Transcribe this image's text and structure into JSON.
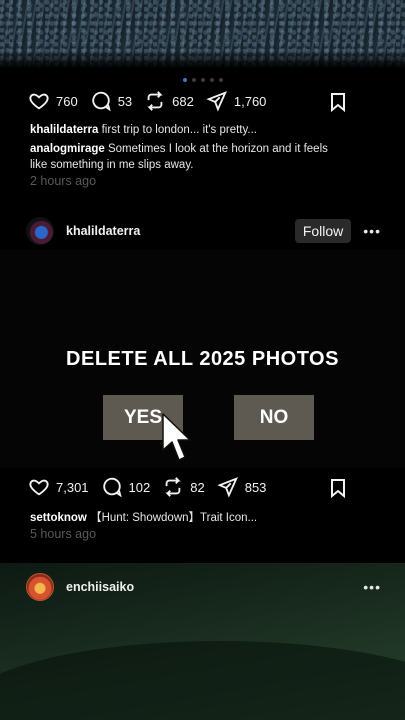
{
  "post1": {
    "likes": "760",
    "comments": "53",
    "reposts": "682",
    "shares": "1,760",
    "caption_user": "khalildaterra",
    "caption_text": "first trip to london... it's pretty...",
    "comment_user": "analogmirage",
    "comment_text": "Sometimes I look at the horizon and it feels like something in me slips away.",
    "timestamp": "2 hours ago"
  },
  "profile1": {
    "username": "khalildaterra",
    "follow_label": "Follow",
    "more_label": "•••"
  },
  "dialog": {
    "title": "DELETE ALL 2025 PHOTOS",
    "yes_label": "YES",
    "no_label": "NO"
  },
  "post2": {
    "likes": "7,301",
    "comments": "102",
    "reposts": "82",
    "shares": "853",
    "caption_user": "settoknow",
    "caption_text": "【Hunt: Showdown】Trait Icon...",
    "timestamp": "5 hours ago"
  },
  "profile2": {
    "username": "enchiisaiko",
    "more_label": "•••"
  },
  "carousel": {
    "count": 5,
    "active_index": 0
  },
  "icons": [
    "heart-icon",
    "comment-icon",
    "repost-icon",
    "share-icon",
    "bookmark-icon",
    "cursor-icon"
  ],
  "colors": {
    "dialog_button": "#5f5a51",
    "carousel_active": "#4a72c9"
  }
}
